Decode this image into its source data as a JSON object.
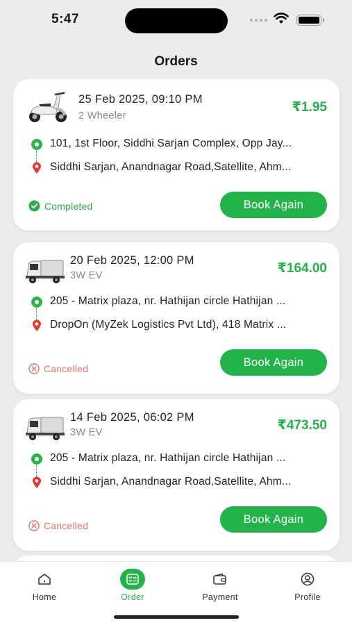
{
  "status_bar": {
    "time": "5:47"
  },
  "header": {
    "title": "Orders"
  },
  "orders": [
    {
      "date": "25 Feb 2025, 09:10 PM",
      "vehicle_type": "2 Wheeler",
      "vehicle_icon": "scooter-icon",
      "price": "₹1.95",
      "pickup": "101, 1st Floor, Siddhi Sarjan Complex, Opp Jay...",
      "drop": "Siddhi Sarjan, Anandnagar Road,Satellite, Ahm...",
      "status": "Completed",
      "status_color": "#34a853",
      "action_label": "Book Again"
    },
    {
      "date": "20 Feb 2025, 12:00 PM",
      "vehicle_type": "3W EV",
      "vehicle_icon": "three-wheeler-truck-icon",
      "price": "₹164.00",
      "pickup": "205 - Matrix plaza, nr. Hathijan circle Hathijan ...",
      "drop": "DropOn (MyZek Logistics Pvt Ltd), 418 Matrix ...",
      "status": "Cancelled",
      "status_color": "#e57373",
      "action_label": "Book Again"
    },
    {
      "date": "14 Feb 2025, 06:02 PM",
      "vehicle_type": "3W EV",
      "vehicle_icon": "three-wheeler-truck-icon",
      "price": "₹473.50",
      "pickup": "205 - Matrix plaza, nr. Hathijan circle Hathijan ...",
      "drop": "Siddhi Sarjan, Anandnagar Road,Satellite, Ahm...",
      "status": "Cancelled",
      "status_color": "#e57373",
      "action_label": "Book Again"
    }
  ],
  "bottom_nav": [
    {
      "label": "Home",
      "icon": "home-icon",
      "active": false
    },
    {
      "label": "Order",
      "icon": "order-list-icon",
      "active": true
    },
    {
      "label": "Payment",
      "icon": "wallet-icon",
      "active": false
    },
    {
      "label": "Profile",
      "icon": "profile-icon",
      "active": false
    }
  ],
  "colors": {
    "accent": "#24b34b",
    "cancel": "#e57373",
    "background": "#ececec"
  }
}
